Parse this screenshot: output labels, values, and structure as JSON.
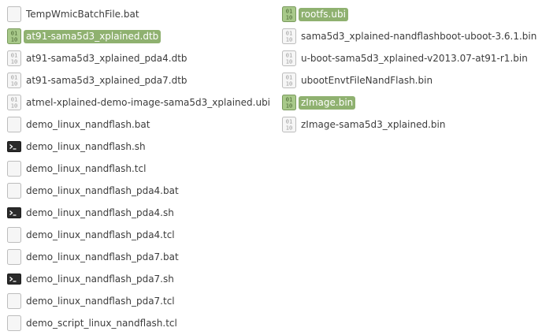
{
  "left_column": [
    {
      "name": "TempWmicBatchFile.bat",
      "icon": "blank-file-icon",
      "selected": false
    },
    {
      "name": "at91-sama5d3_xplained.dtb",
      "icon": "binary-file-icon",
      "selected": true
    },
    {
      "name": "at91-sama5d3_xplained_pda4.dtb",
      "icon": "binary-file-icon",
      "selected": false
    },
    {
      "name": "at91-sama5d3_xplained_pda7.dtb",
      "icon": "binary-file-icon",
      "selected": false
    },
    {
      "name": "atmel-xplained-demo-image-sama5d3_xplained.ubi",
      "icon": "binary-file-icon",
      "selected": false
    },
    {
      "name": "demo_linux_nandflash.bat",
      "icon": "blank-file-icon",
      "selected": false
    },
    {
      "name": "demo_linux_nandflash.sh",
      "icon": "terminal-icon",
      "selected": false
    },
    {
      "name": "demo_linux_nandflash.tcl",
      "icon": "blank-file-icon",
      "selected": false
    },
    {
      "name": "demo_linux_nandflash_pda4.bat",
      "icon": "blank-file-icon",
      "selected": false
    },
    {
      "name": "demo_linux_nandflash_pda4.sh",
      "icon": "terminal-icon",
      "selected": false
    },
    {
      "name": "demo_linux_nandflash_pda4.tcl",
      "icon": "blank-file-icon",
      "selected": false
    },
    {
      "name": "demo_linux_nandflash_pda7.bat",
      "icon": "blank-file-icon",
      "selected": false
    },
    {
      "name": "demo_linux_nandflash_pda7.sh",
      "icon": "terminal-icon",
      "selected": false
    },
    {
      "name": "demo_linux_nandflash_pda7.tcl",
      "icon": "blank-file-icon",
      "selected": false
    },
    {
      "name": "demo_script_linux_nandflash.tcl",
      "icon": "blank-file-icon",
      "selected": false
    }
  ],
  "right_column": [
    {
      "name": "rootfs.ubi",
      "icon": "binary-file-icon",
      "selected": true
    },
    {
      "name": "sama5d3_xplained-nandflashboot-uboot-3.6.1.bin",
      "icon": "binary-file-icon",
      "selected": false
    },
    {
      "name": "u-boot-sama5d3_xplained-v2013.07-at91-r1.bin",
      "icon": "binary-file-icon",
      "selected": false
    },
    {
      "name": "ubootEnvtFileNandFlash.bin",
      "icon": "binary-file-icon",
      "selected": false
    },
    {
      "name": "zImage.bin",
      "icon": "binary-file-icon",
      "selected": true
    },
    {
      "name": "zImage-sama5d3_xplained.bin",
      "icon": "binary-file-icon",
      "selected": false
    }
  ],
  "icon_glyph": {
    "bits_top": "01",
    "bits_bottom": "10"
  },
  "colors": {
    "selection": "#8fb170",
    "selected_icon_bg": "#a8c98a",
    "terminal_bg": "#2b2b2b"
  }
}
